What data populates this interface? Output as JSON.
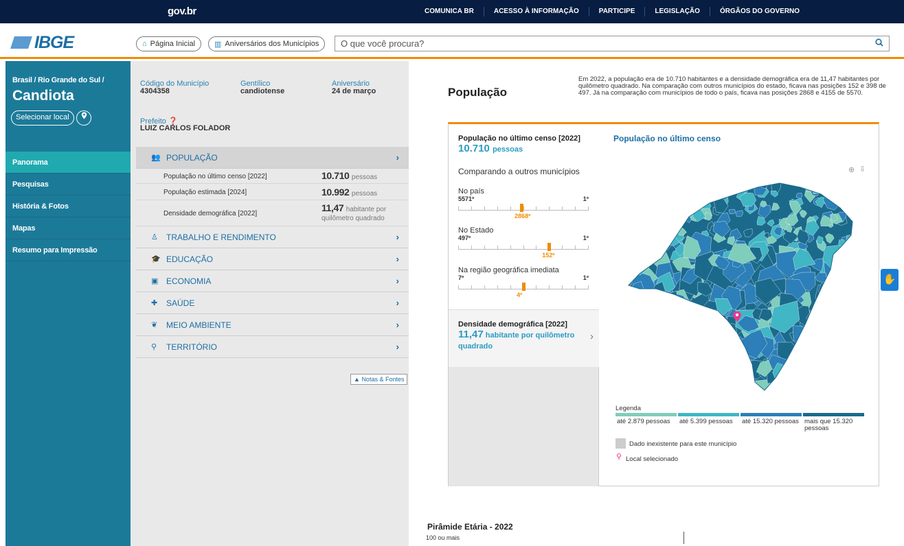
{
  "govbar": {
    "logo": "gov.br",
    "links": [
      "COMUNICA BR",
      "ACESSO À INFORMAÇÃO",
      "PARTICIPE",
      "LEGISLAÇÃO",
      "ÓRGÃOS DO GOVERNO"
    ]
  },
  "header": {
    "logo": "IBGE",
    "home_label": "Página Inicial",
    "anniv_label": "Aniversários dos Municípios",
    "search_placeholder": "O que você procura?"
  },
  "sidebar": {
    "breadcrumb": "Brasil / Rio Grande do Sul /",
    "city": "Candiota",
    "select_label": "Selecionar local",
    "items": [
      {
        "label": "Panorama"
      },
      {
        "label": "Pesquisas"
      },
      {
        "label": "História & Fotos"
      },
      {
        "label": "Mapas"
      },
      {
        "label": "Resumo para Impressão"
      }
    ]
  },
  "info": {
    "codigo_label": "Código do Município",
    "codigo": "4304358",
    "gentilico_label": "Gentílico",
    "gentilico": "candiotense",
    "aniversario_label": "Aniversário",
    "aniversario": "24 de março",
    "prefeito_label": "Prefeito",
    "prefeito": "LUIZ CARLOS FOLADOR"
  },
  "sections": {
    "populacao": "POPULAÇÃO",
    "trabalho": "TRABALHO E RENDIMENTO",
    "educacao": "EDUCAÇÃO",
    "economia": "ECONOMIA",
    "saude": "SAÚDE",
    "meio": "MEIO AMBIENTE",
    "territorio": "TERRITÓRIO"
  },
  "pop_rows": [
    {
      "label": "População no último censo [2022]",
      "value": "10.710",
      "unit": "pessoas"
    },
    {
      "label": "População estimada [2024]",
      "value": "10.992",
      "unit": "pessoas"
    },
    {
      "label": "Densidade demográfica [2022]",
      "value": "11,47",
      "unit": "habitante por",
      "unit2": "quilômetro quadrado"
    }
  ],
  "notas_label": "Notas & Fontes",
  "right": {
    "title": "População",
    "desc": "Em 2022, a população era de 10.710 habitantes e a densidade demográfica era de 11,47 habitantes por quilômetro quadrado. Na comparação com outros municípios do estado, ficava nas posições 152 e 398 de 497. Já na comparação com municípios de todo o país, ficava nas posições 2868 e 4155 de 5570.",
    "card_title": "População no último censo [2022]",
    "card_value": "10.710",
    "card_unit": "pessoas",
    "compare_title": "Comparando a outros municípios",
    "ranks": [
      {
        "name": "No país",
        "min": "5571º",
        "max": "1º",
        "pos": "2868º",
        "fraction": 0.485
      },
      {
        "name": "No Estado",
        "min": "497º",
        "max": "1º",
        "pos": "152º",
        "fraction": 0.696
      },
      {
        "name": "Na região geográfica imediata",
        "min": "7º",
        "max": "1º",
        "pos": "4º",
        "fraction": 0.5
      }
    ],
    "dens_title": "Densidade demográfica [2022]",
    "dens_value": "11,47",
    "dens_unit": "habitante por quilômetro quadrado",
    "map_title": "População no último censo",
    "legend_title": "Legenda",
    "legend": [
      {
        "label": "até 2.879 pessoas",
        "color": "#7fcdbb"
      },
      {
        "label": "até 5.399 pessoas",
        "color": "#41b6c4"
      },
      {
        "label": "até 15.320 pessoas",
        "color": "#2c7fb8"
      },
      {
        "label": "mais que 15.320 pessoas",
        "color": "#1b6a8c"
      }
    ],
    "legend_na": "Dado inexistente para este município",
    "legend_sel": "Local selecionado",
    "pyramid_title": "Pirâmide Etária - 2022",
    "pyramid_first": "100 ou mais"
  }
}
